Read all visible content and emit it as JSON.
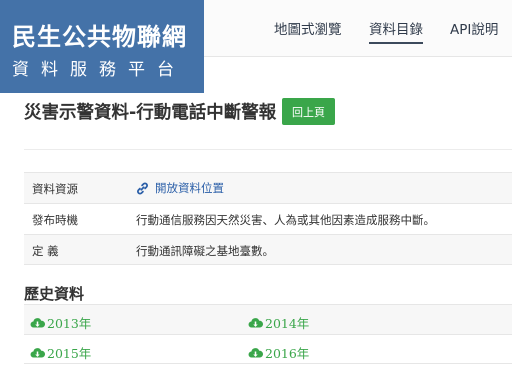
{
  "logo": {
    "line1": "民生公共物聯網",
    "line2": "資料服務平台"
  },
  "nav": {
    "map": "地圖式瀏覽",
    "catalog": "資料目錄",
    "api": "API說明"
  },
  "page": {
    "title": "災害示警資料-行動電話中斷警報",
    "back_button": "回上頁"
  },
  "info": {
    "resource_label": "資料資源",
    "resource_link": "開放資料位置",
    "publish_label": "發布時機",
    "publish_value": "行動通信服務因天然災害、人為或其他因素造成服務中斷。",
    "definition_label": "定 義",
    "definition_value": "行動通訊障礙之基地臺數。"
  },
  "history": {
    "title": "歷史資料",
    "years": [
      "2013年",
      "2014年",
      "2015年",
      "2016年"
    ]
  },
  "colors": {
    "brand": "#4472a8",
    "accent_green": "#3aa64a",
    "link": "#2b5fa8"
  }
}
